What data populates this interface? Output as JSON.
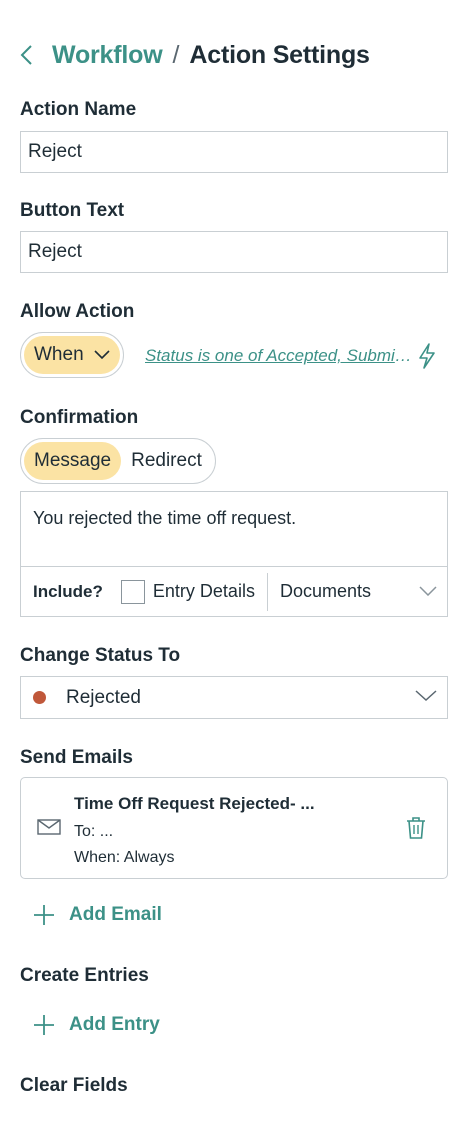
{
  "header": {
    "back_icon": "chevron-left-icon",
    "breadcrumb_parent": "Workflow",
    "separator": "/",
    "breadcrumb_current": "Action Settings"
  },
  "action_name": {
    "label": "Action Name",
    "value": "Reject"
  },
  "button_text": {
    "label": "Button Text",
    "value": "Reject"
  },
  "allow_action": {
    "label": "Allow Action",
    "mode": "When",
    "condition": "Status is one of Accepted, Submitted",
    "condition_icon": "lightning-bolt-icon"
  },
  "confirmation": {
    "label": "Confirmation",
    "options": [
      "Message",
      "Redirect"
    ],
    "selected": "Message",
    "message": "You rejected the time off request.",
    "include_label": "Include?",
    "entry_details_label": "Entry Details",
    "entry_details_checked": false,
    "documents_placeholder": "Documents"
  },
  "change_status": {
    "label": "Change Status To",
    "value": "Rejected",
    "dot_color": "#c0583a"
  },
  "send_emails": {
    "label": "Send Emails",
    "items": [
      {
        "title": "Time Off Request Rejected- ...",
        "to": "To: ...",
        "when": "When: Always"
      }
    ],
    "add_label": "Add Email"
  },
  "create_entries": {
    "label": "Create Entries",
    "add_label": "Add Entry"
  },
  "clear_fields": {
    "label": "Clear Fields"
  },
  "colors": {
    "accent": "#3c9187",
    "active_pill": "#fbe3a4",
    "border": "#c9cfd3",
    "text": "#1f2d36"
  }
}
